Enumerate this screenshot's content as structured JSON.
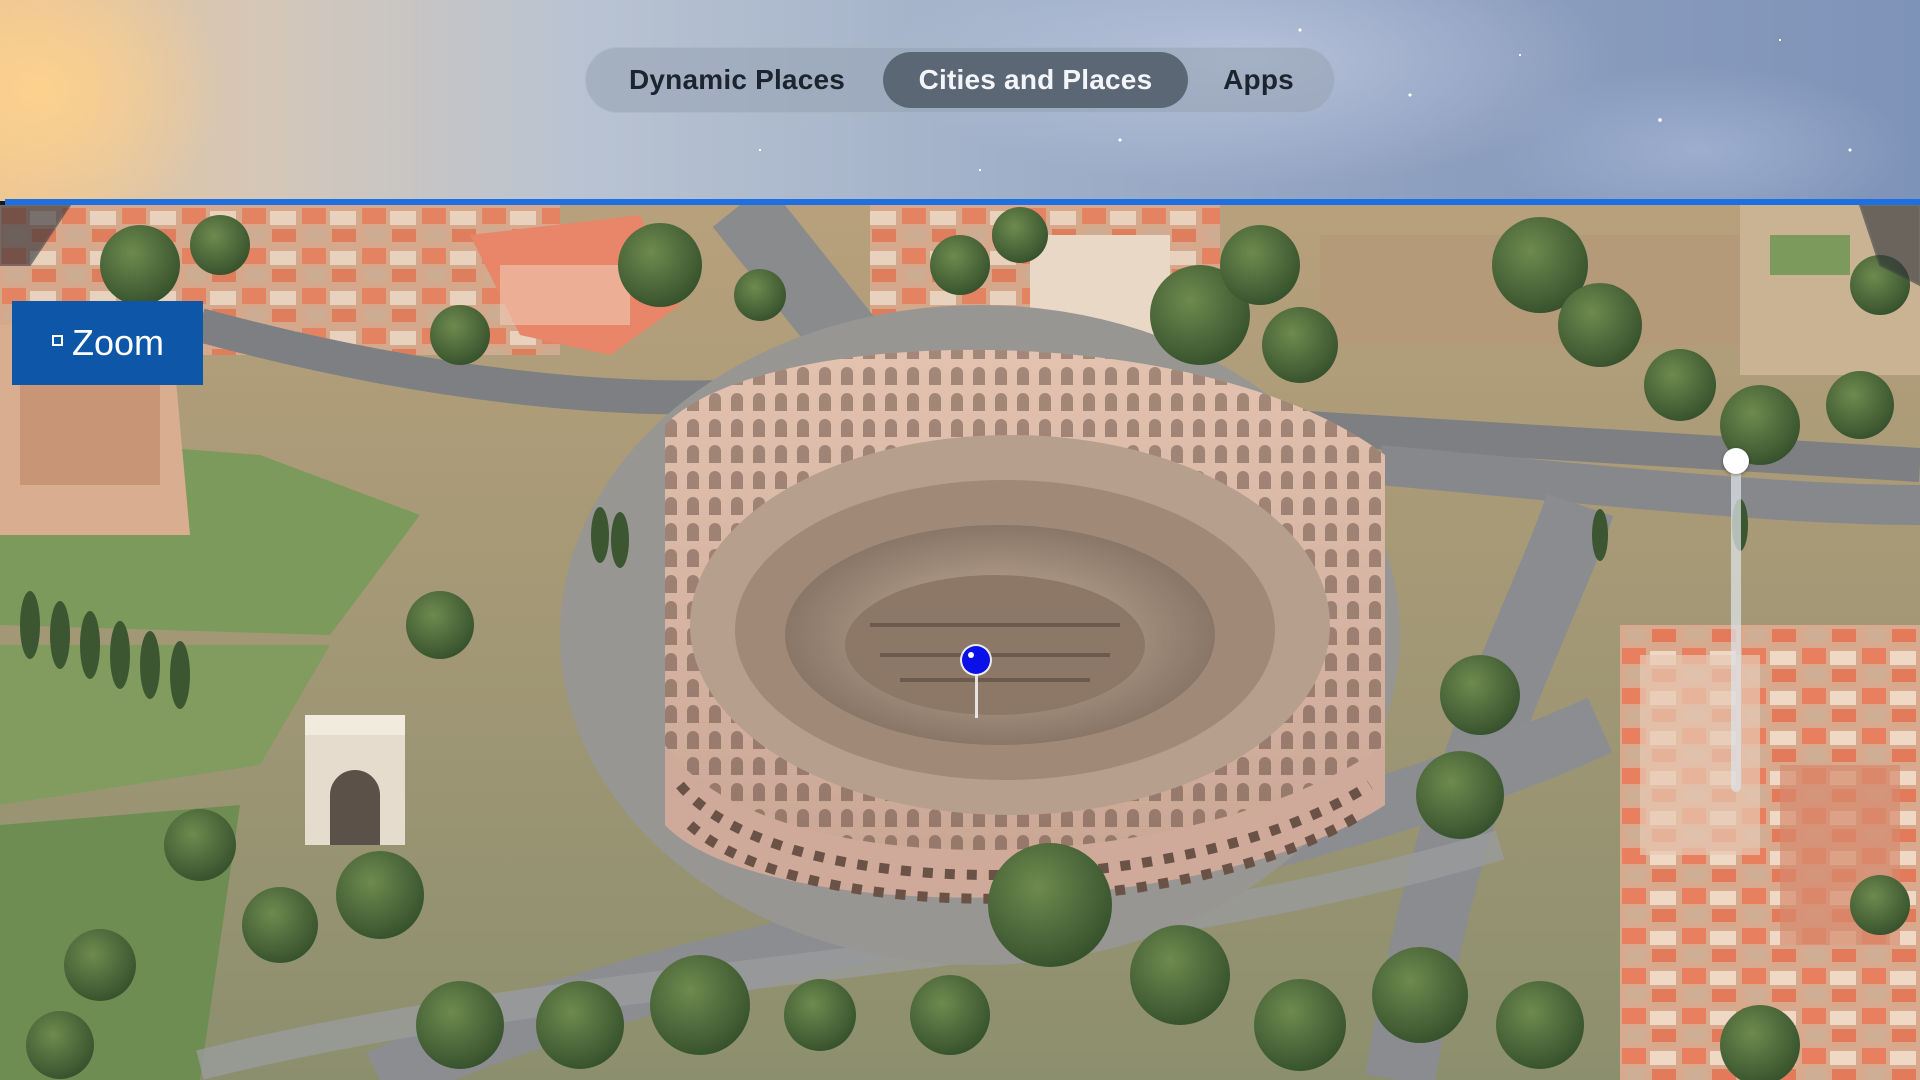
{
  "tabs": {
    "items": [
      {
        "label": "Dynamic Places",
        "selected": false
      },
      {
        "label": "Cities and Places",
        "selected": true
      },
      {
        "label": "Apps",
        "selected": false
      }
    ]
  },
  "map": {
    "view": "3D flyover",
    "landmark": "colosseum-icon",
    "pin_color": "#0a10e8"
  },
  "zoom_button": {
    "label": "Zoom",
    "icon": "zoom-dashed-square-icon",
    "color": "#0d56a8"
  },
  "slider": {
    "orientation": "vertical",
    "value": 1.0
  },
  "accent_color": "#1e6fe0"
}
